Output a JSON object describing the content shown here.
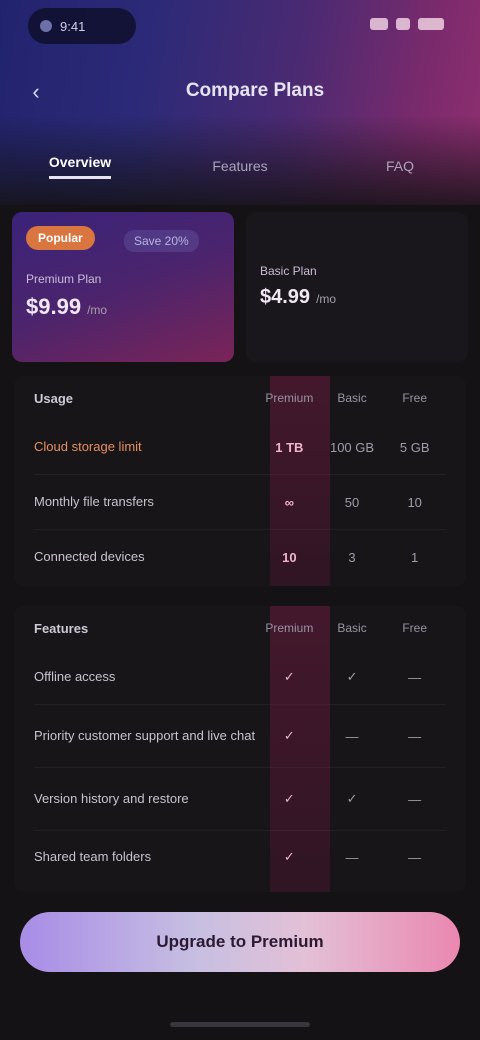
{
  "status_bar": {
    "time": "9:41"
  },
  "header": {
    "title": "Compare Plans",
    "back_label": "‹"
  },
  "tabs": [
    {
      "label": "Overview",
      "active": true
    },
    {
      "label": "Features",
      "active": false
    },
    {
      "label": "FAQ",
      "active": false
    }
  ],
  "cards": {
    "primary": {
      "badge": "Popular",
      "sub_badge": "Save 20%",
      "label": "Premium Plan",
      "value": "$9.99",
      "unit": "/mo"
    },
    "secondary": {
      "label": "Basic Plan",
      "value": "$4.99",
      "unit": "/mo"
    }
  },
  "section1": {
    "title": "Usage",
    "columns": [
      "Premium",
      "Basic",
      "Free"
    ],
    "rows": [
      {
        "name": "Cloud storage limit",
        "hot": true,
        "values": [
          "1 TB",
          "100 GB",
          "5 GB"
        ]
      },
      {
        "name": "Monthly file transfers",
        "hot": false,
        "values": [
          "∞",
          "50",
          "10"
        ]
      },
      {
        "name": "Connected devices",
        "hot": false,
        "values": [
          "10",
          "3",
          "1"
        ]
      }
    ]
  },
  "section2": {
    "title": "Features",
    "columns": [
      "Premium",
      "Basic",
      "Free"
    ],
    "rows": [
      {
        "name": "Offline access",
        "values": [
          "✓",
          "✓",
          "—"
        ]
      },
      {
        "name": "Priority customer support and live chat",
        "values": [
          "✓",
          "—",
          "—"
        ]
      },
      {
        "name": "Version history and restore",
        "values": [
          "✓",
          "✓",
          "—"
        ]
      },
      {
        "name": "Shared team folders",
        "values": [
          "✓",
          "—",
          "—"
        ]
      }
    ]
  },
  "cta": {
    "label": "Upgrade to Premium"
  },
  "colors": {
    "accent": "#ea87b0",
    "badge": "#d9753f",
    "background": "#141214"
  }
}
